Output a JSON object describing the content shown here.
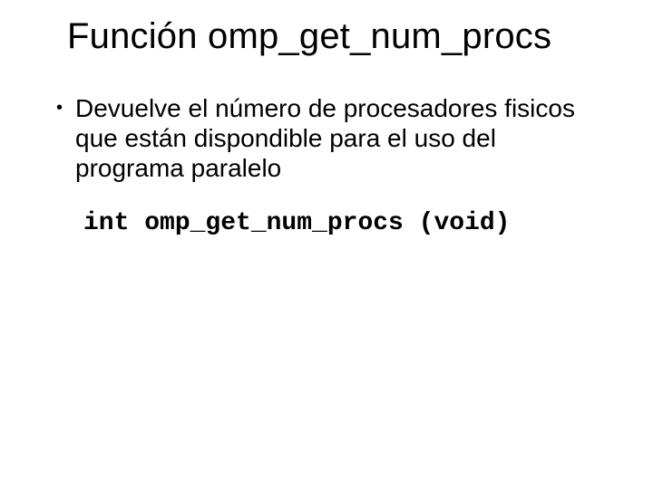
{
  "title": "Función omp_get_num_procs",
  "bullet": {
    "dot": "•",
    "text": "Devuelve el número de procesadores fisicos que están dispondible para el uso del programa paralelo"
  },
  "code": "int omp_get_num_procs (void)"
}
